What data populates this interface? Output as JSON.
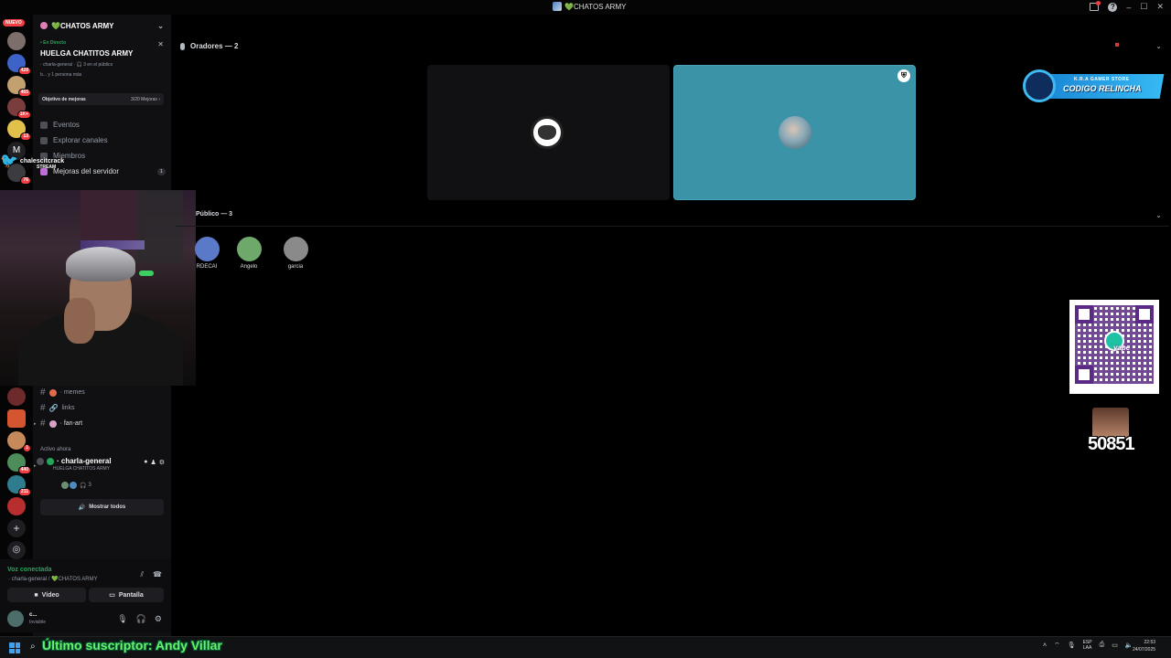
{
  "titlebar": {
    "title": "💚CHATOS ARMY"
  },
  "rail": {
    "new_badge": "NUEVO",
    "badges": [
      "428",
      "465",
      "1K+",
      "13",
      "76",
      "1",
      "440",
      "211"
    ]
  },
  "server": {
    "name": "💚CHATOS ARMY",
    "live_label": "• En Directo",
    "live_title": "HUELGA CHATITOS ARMY",
    "live_meta": "· charla-general · 🎧 3 en el público",
    "live_people": "b... y 1 persona más",
    "boost_label": "Objetivo de mejoras",
    "boost_value": "3/20 Mejoras ›",
    "nav": {
      "events": "Eventos",
      "explore": "Explorar canales",
      "members": "Miembros",
      "boosts": "Mejoras del servidor",
      "boosts_count": "1"
    }
  },
  "overlay": {
    "twitter_handle": "chalescitcrack",
    "stream_tag": "STREAM",
    "promo_top": "K.R.A GAMER STORE",
    "promo_code": "CODIGO RELINCHA",
    "yape": "yape",
    "sub_count": "50851",
    "ticker": "Último suscriptor: Andy Villar"
  },
  "channels": {
    "memes": "· memes",
    "links": "links",
    "fanart": "· fan-art",
    "active_now": "Activo ahora",
    "voice_channel": "· charla-general",
    "voice_channel_sub": "HUELGA CHATITOS ARMY",
    "listeners": "3",
    "show_all": "Mostrar todos"
  },
  "voice_panel": {
    "connected": "Voz conectada",
    "location": "· charla-general / 💚CHATOS ARMY",
    "video_btn": "Vídeo",
    "screen_btn": "Pantalla"
  },
  "user": {
    "name": "c...",
    "status": "Invisible"
  },
  "stage": {
    "speakers_header": "Oradores — 2",
    "audience_header": "Público — 3",
    "audience": [
      {
        "name": "RDECAI",
        "color": "#5a79c8"
      },
      {
        "name": "Angelo",
        "color": "#6fa86b"
      },
      {
        "name": "garcia",
        "color": "#8a8a8a"
      }
    ]
  },
  "taskbar": {
    "lang_top": "ESP",
    "lang_bottom": "LAA",
    "time": "22:53",
    "date": "24/07/2025"
  }
}
